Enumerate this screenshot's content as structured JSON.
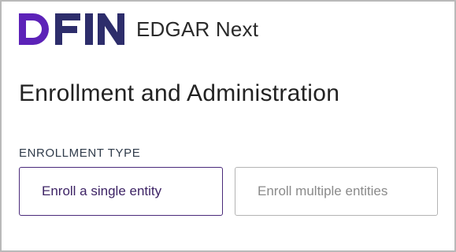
{
  "header": {
    "logo_text": "DFIN",
    "app_name": "EDGAR Next"
  },
  "page": {
    "title": "Enrollment and Administration"
  },
  "enrollment_type": {
    "label": "ENROLLMENT TYPE",
    "options": [
      {
        "label": "Enroll a single entity",
        "selected": true
      },
      {
        "label": "Enroll multiple entities",
        "selected": false
      }
    ]
  },
  "colors": {
    "brand_purple": "#5c22b8",
    "selected_border": "#4a2a7a",
    "unselected_border": "#b4b4b4"
  }
}
